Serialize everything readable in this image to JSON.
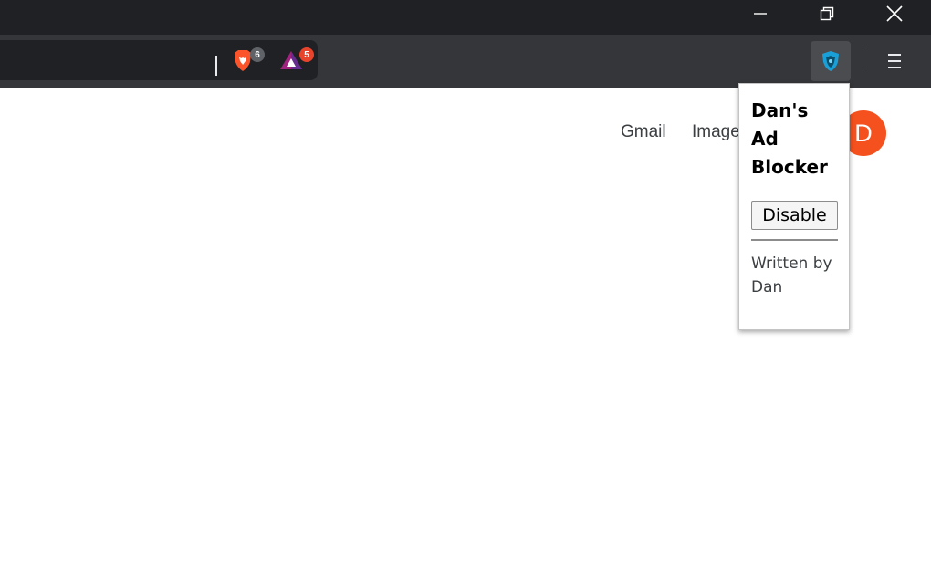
{
  "browser": {
    "window_controls": {
      "minimize": "minimize-icon",
      "restore": "restore-icon",
      "close": "close-icon"
    },
    "extensions": {
      "shields_badge": "6",
      "rewards_badge": "5",
      "active_extension_icon": "shield-icon"
    },
    "menu_icon": "hamburger-menu-icon",
    "colors": {
      "titlebar": "#202124",
      "toolbar": "#35363a",
      "badge_shields": "#5f6368",
      "badge_rewards": "#e8432b"
    }
  },
  "page": {
    "links": {
      "gmail": "Gmail",
      "images": "Images"
    },
    "avatar_initial": "D",
    "avatar_color": "#f4511e"
  },
  "popup": {
    "title": "Dan's Ad Blocker",
    "button_label": "Disable",
    "footer": "Written by Dan"
  }
}
